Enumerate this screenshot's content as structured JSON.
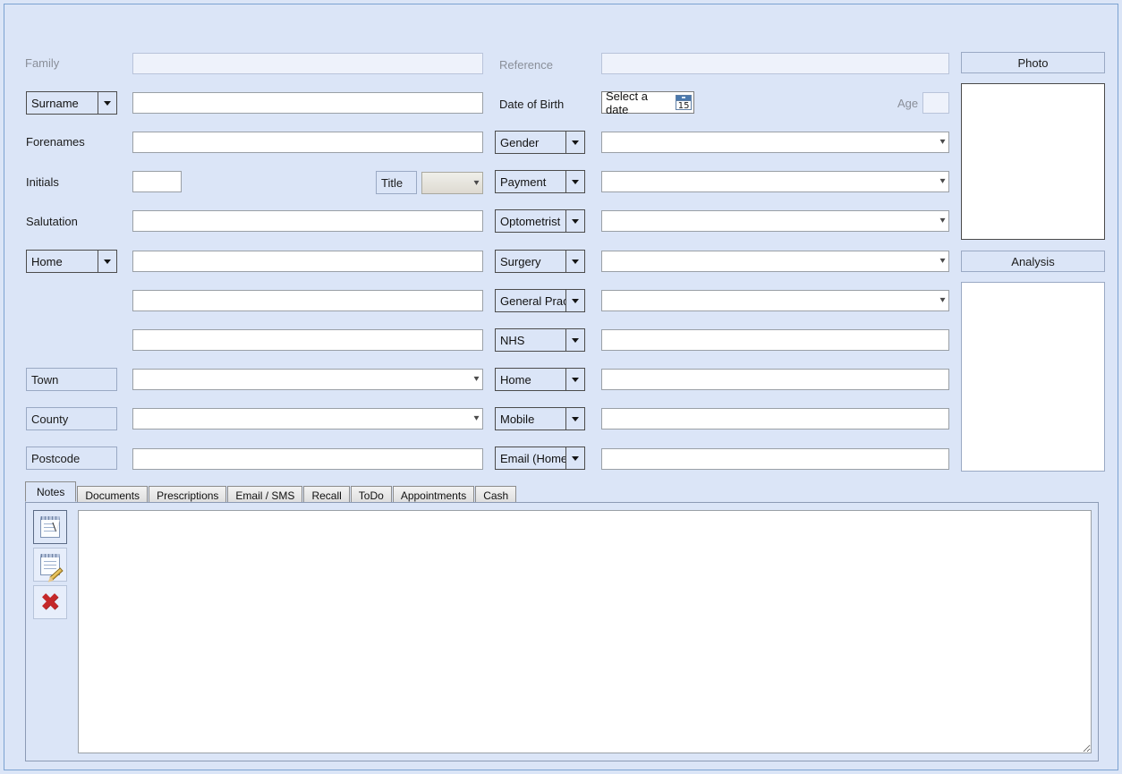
{
  "form": {
    "family": {
      "label": "Family",
      "value": "",
      "placeholder": ""
    },
    "reference": {
      "label": "Reference",
      "value": "",
      "placeholder": ""
    },
    "surname": {
      "label": "Surname",
      "value": "",
      "placeholder": ""
    },
    "date_of_birth": {
      "label": "Date of Birth",
      "value": "Select a date",
      "calendar_day": "15"
    },
    "age": {
      "label": "Age",
      "value": ""
    },
    "forenames": {
      "label": "Forenames",
      "value": ""
    },
    "gender": {
      "label": "Gender",
      "value": ""
    },
    "initials": {
      "label": "Initials",
      "value": ""
    },
    "title": {
      "label": "Title",
      "value": ""
    },
    "payment": {
      "label": "Payment",
      "value": ""
    },
    "salutation": {
      "label": "Salutation",
      "value": ""
    },
    "optometrist": {
      "label": "Optometrist",
      "value": ""
    },
    "address_type": {
      "label": "Home",
      "value": ""
    },
    "surgery": {
      "label": "Surgery",
      "value": ""
    },
    "address_line2": {
      "value": ""
    },
    "general_practitioner": {
      "label": "General Prac..",
      "value": ""
    },
    "address_line3": {
      "value": ""
    },
    "nhs": {
      "label": "NHS",
      "value": ""
    },
    "town": {
      "label": "Town",
      "value": ""
    },
    "phone_home": {
      "label": "Home",
      "value": ""
    },
    "county": {
      "label": "County",
      "value": ""
    },
    "phone_mobile": {
      "label": "Mobile",
      "value": ""
    },
    "postcode": {
      "label": "Postcode",
      "value": ""
    },
    "email_home": {
      "label": "Email (Home)",
      "value": ""
    }
  },
  "side": {
    "photo_label": "Photo",
    "analysis_label": "Analysis"
  },
  "tabs": [
    {
      "label": "Notes",
      "active": true
    },
    {
      "label": "Documents",
      "active": false
    },
    {
      "label": "Prescriptions",
      "active": false
    },
    {
      "label": "Email / SMS",
      "active": false
    },
    {
      "label": "Recall",
      "active": false
    },
    {
      "label": "ToDo",
      "active": false
    },
    {
      "label": "Appointments",
      "active": false
    },
    {
      "label": "Cash",
      "active": false
    }
  ],
  "notes_toolbar": [
    {
      "name": "new-note-icon",
      "selected": true
    },
    {
      "name": "edit-note-icon",
      "selected": false
    },
    {
      "name": "delete-note-icon",
      "selected": false
    }
  ],
  "notes_text": "",
  "colors": {
    "background": "#dbe5f7",
    "window_border": "#7ba2d1",
    "field_border": "#9aa0a6",
    "combo_border": "#4c4c4c",
    "label_box_border": "#9aa9c4",
    "dim_label": "#8a8f99",
    "delete_red": "#c4282a",
    "calendar_blue": "#4a78ad"
  }
}
